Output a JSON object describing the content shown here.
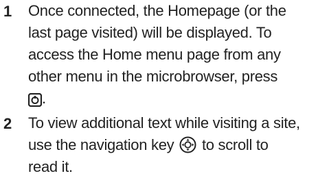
{
  "steps": [
    {
      "number": "1",
      "lines": [
        "Once connected, the Homepage (or the",
        "last page visited) will be displayed. To",
        "access the Home menu page from any",
        "other menu in the microbrowser, press"
      ],
      "after_icon": ".",
      "icon": "menu-key-icon"
    },
    {
      "number": "2",
      "lines": [
        "To view additional text while visiting a site,"
      ],
      "line2_before": "use the navigation key",
      "line2_after": "to scroll to",
      "line3": "read it.",
      "icon": "navigation-key-icon"
    }
  ]
}
